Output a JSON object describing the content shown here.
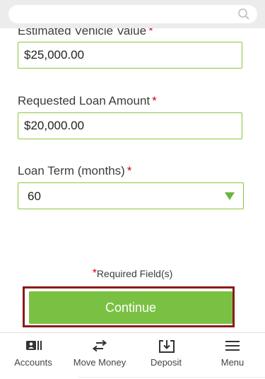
{
  "search": {
    "placeholder": ""
  },
  "form": {
    "vehicle_value": {
      "label": "Estimated Vehicle Value",
      "value": "$25,000.00"
    },
    "loan_amount": {
      "label": "Requested Loan Amount",
      "value": "$20,000.00"
    },
    "loan_term": {
      "label": "Loan Term (months)",
      "selected": "60"
    },
    "required_star": "*",
    "required_note": "Required Field(s)",
    "continue_label": "Continue"
  },
  "tabbar": {
    "items": [
      {
        "label": "Accounts",
        "icon": "accounts-icon"
      },
      {
        "label": "Move Money",
        "icon": "transfer-arrows-icon"
      },
      {
        "label": "Deposit",
        "icon": "deposit-icon"
      },
      {
        "label": "Menu",
        "icon": "hamburger-menu-icon"
      }
    ]
  },
  "colors": {
    "accent": "#7ac143",
    "required": "#d0021b",
    "focus_outline": "#8b1a1a"
  }
}
